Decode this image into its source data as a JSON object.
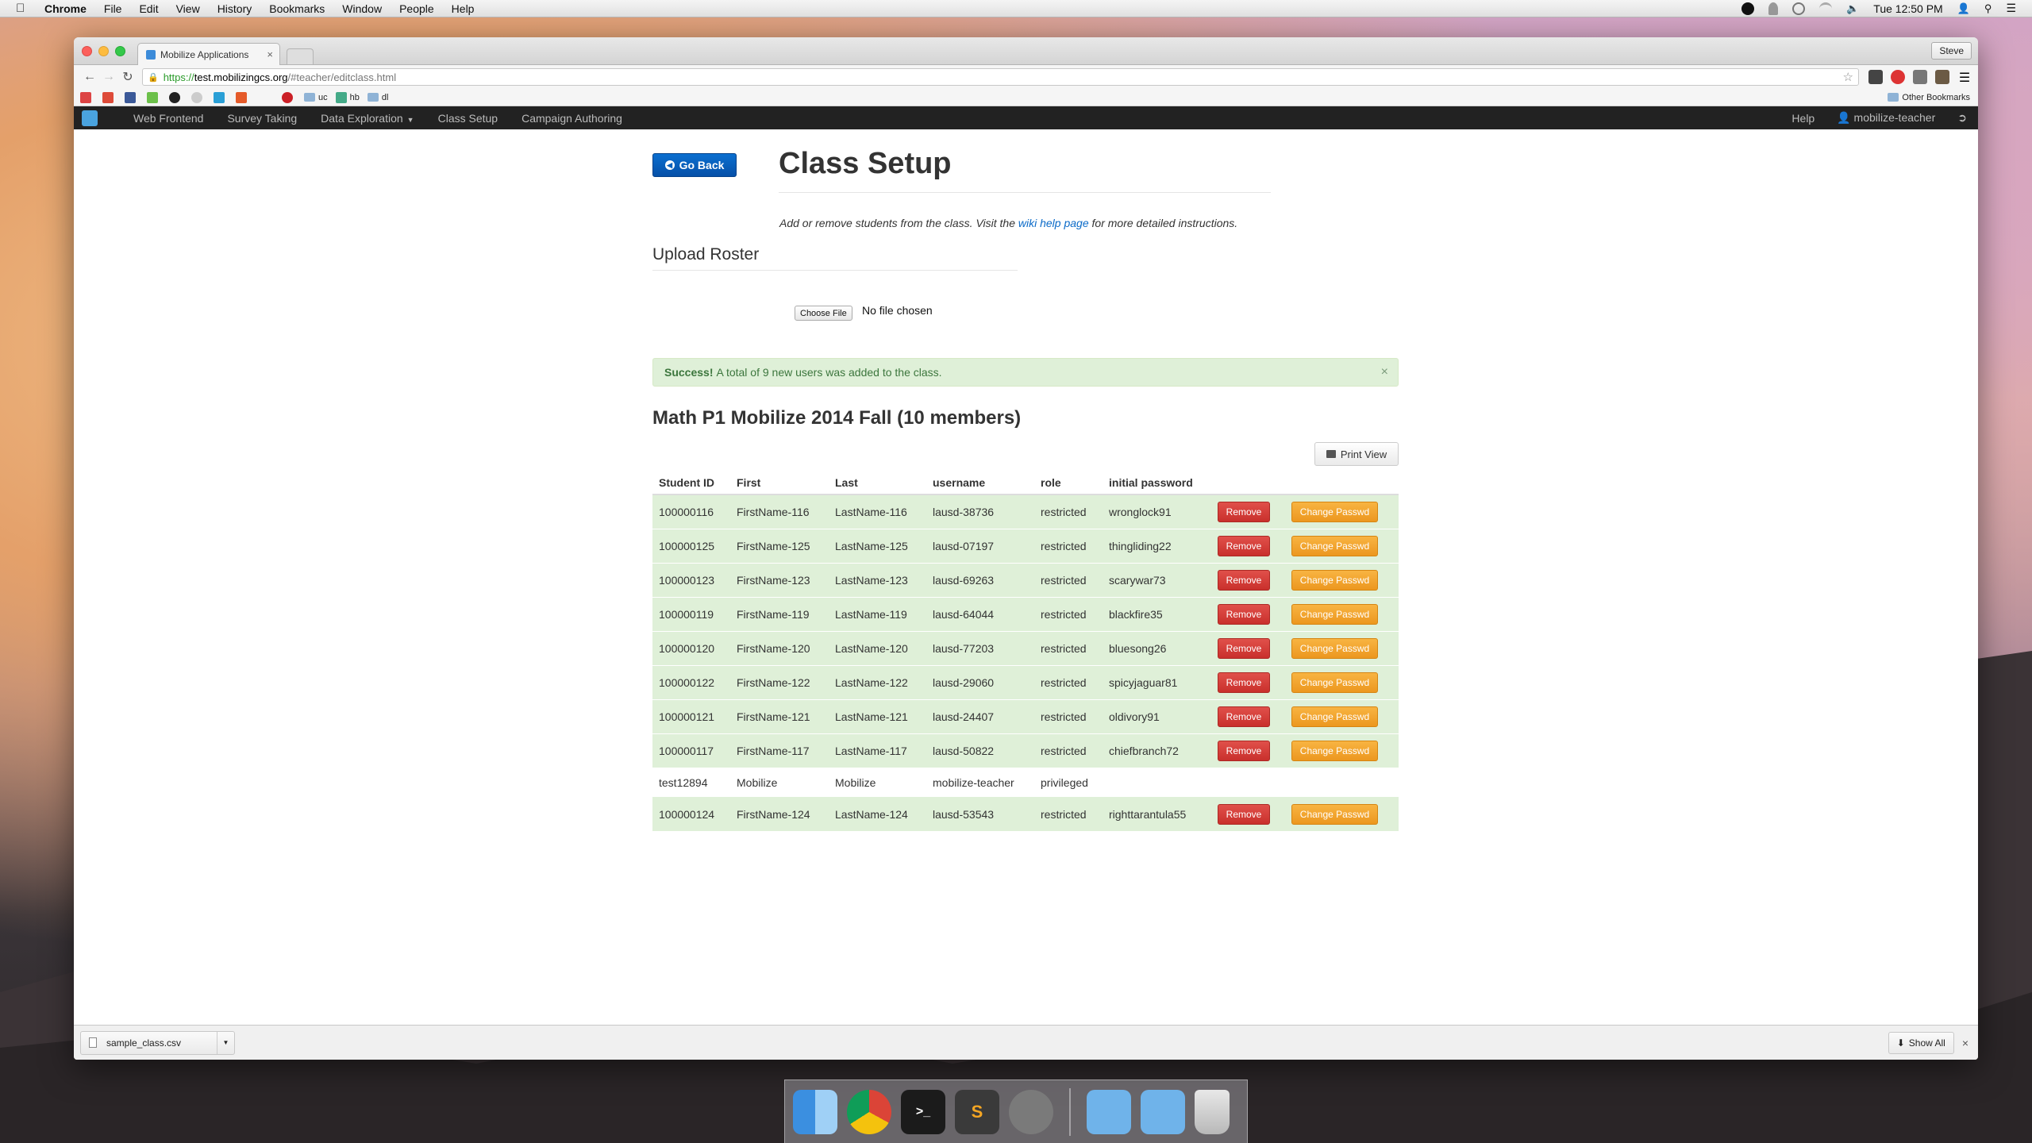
{
  "menubar": {
    "app": "Chrome",
    "items": [
      "File",
      "Edit",
      "View",
      "History",
      "Bookmarks",
      "Window",
      "People",
      "Help"
    ],
    "clock": "Tue 12:50 PM"
  },
  "browser": {
    "tab_title": "Mobilize Applications",
    "profile": "Steve",
    "url_scheme": "https://",
    "url_host": "test.mobilizingcs.org",
    "url_path": "/#teacher/editclass.html",
    "bookmarks": [
      "uc",
      "hb",
      "dl"
    ],
    "other_bookmarks": "Other Bookmarks"
  },
  "appnav": {
    "items": [
      "Web Frontend",
      "Survey Taking",
      "Data Exploration",
      "Class Setup",
      "Campaign Authoring"
    ],
    "help": "Help",
    "user": "mobilize-teacher"
  },
  "page": {
    "go_back": "Go Back",
    "title": "Class Setup",
    "intro_before": "Add or remove students from the class. Visit the ",
    "intro_link": "wiki help page",
    "intro_after": " for more detailed instructions.",
    "upload_title": "Upload Roster",
    "choose_file": "Choose File",
    "no_file": "No file chosen",
    "alert_strong": "Success!",
    "alert_text": "A total of 9 new users was added to the class.",
    "alert_close": "×",
    "class_title": "Math P1 Mobilize 2014 Fall (10 members)",
    "print_view": "Print View"
  },
  "table": {
    "headers": [
      "Student ID",
      "First",
      "Last",
      "username",
      "role",
      "initial password"
    ],
    "remove_label": "Remove",
    "change_label": "Change Passwd",
    "rows": [
      [
        "100000116",
        "FirstName-116",
        "LastName-116",
        "lausd-38736",
        "restricted",
        "wronglock91"
      ],
      [
        "100000125",
        "FirstName-125",
        "LastName-125",
        "lausd-07197",
        "restricted",
        "thingliding22"
      ],
      [
        "100000123",
        "FirstName-123",
        "LastName-123",
        "lausd-69263",
        "restricted",
        "scarywar73"
      ],
      [
        "100000119",
        "FirstName-119",
        "LastName-119",
        "lausd-64044",
        "restricted",
        "blackfire35"
      ],
      [
        "100000120",
        "FirstName-120",
        "LastName-120",
        "lausd-77203",
        "restricted",
        "bluesong26"
      ],
      [
        "100000122",
        "FirstName-122",
        "LastName-122",
        "lausd-29060",
        "restricted",
        "spicyjaguar81"
      ],
      [
        "100000121",
        "FirstName-121",
        "LastName-121",
        "lausd-24407",
        "restricted",
        "oldivory91"
      ],
      [
        "100000117",
        "FirstName-117",
        "LastName-117",
        "lausd-50822",
        "restricted",
        "chiefbranch72"
      ],
      [
        "test12894",
        "Mobilize",
        "Mobilize",
        "mobilize-teacher",
        "privileged",
        ""
      ],
      [
        "100000124",
        "FirstName-124",
        "LastName-124",
        "lausd-53543",
        "restricted",
        "righttarantula55"
      ]
    ]
  },
  "downloads": {
    "file": "sample_class.csv",
    "show_all": "Show All"
  },
  "colors": {
    "nav_bg": "#222222",
    "primary": "#0660bd",
    "success_bg": "#dff0d8",
    "danger": "#c9302c",
    "warning": "#ec971f"
  }
}
